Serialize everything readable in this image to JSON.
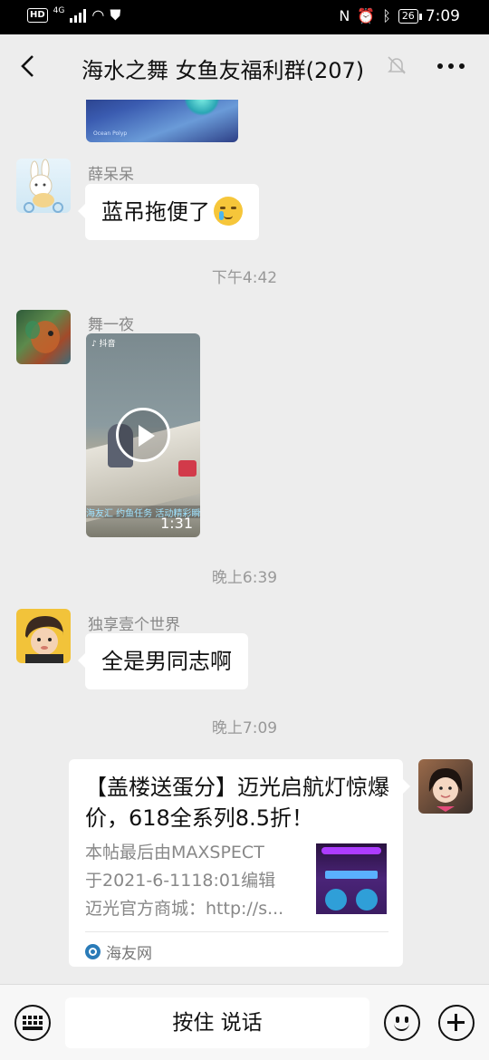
{
  "status_bar": {
    "network": "4G",
    "battery": "26",
    "time": "7:09"
  },
  "header": {
    "title": "海水之舞 女鱼友福利群(207)"
  },
  "colors": {
    "background": "#ededed",
    "bubble": "#ffffff",
    "timestamp": "#999999"
  },
  "messages": [
    {
      "sender": "薛呆呆",
      "text": "蓝吊拖便了",
      "emoji": "crying-face"
    },
    {
      "time": "下午4:42"
    },
    {
      "sender": "舞一夜",
      "video": {
        "duration": "1:31",
        "caption": "海友汇 约鱼任务 活动精彩瞬间"
      }
    },
    {
      "time": "晚上6:39"
    },
    {
      "sender": "独享壹个世界",
      "text": "全是男同志啊"
    },
    {
      "time": "晚上7:09"
    },
    {
      "link_card": {
        "title": "【盖楼送蛋分】迈光启航灯惊爆价，618全系列8.5折！",
        "desc_lines": [
          "本帖最后由MAXSPECT",
          "于2021-6-1118:01编辑",
          "迈光官方商城：http://s..."
        ],
        "source": "海友网"
      }
    }
  ],
  "input_bar": {
    "hold_to_talk": "按住 说话"
  }
}
